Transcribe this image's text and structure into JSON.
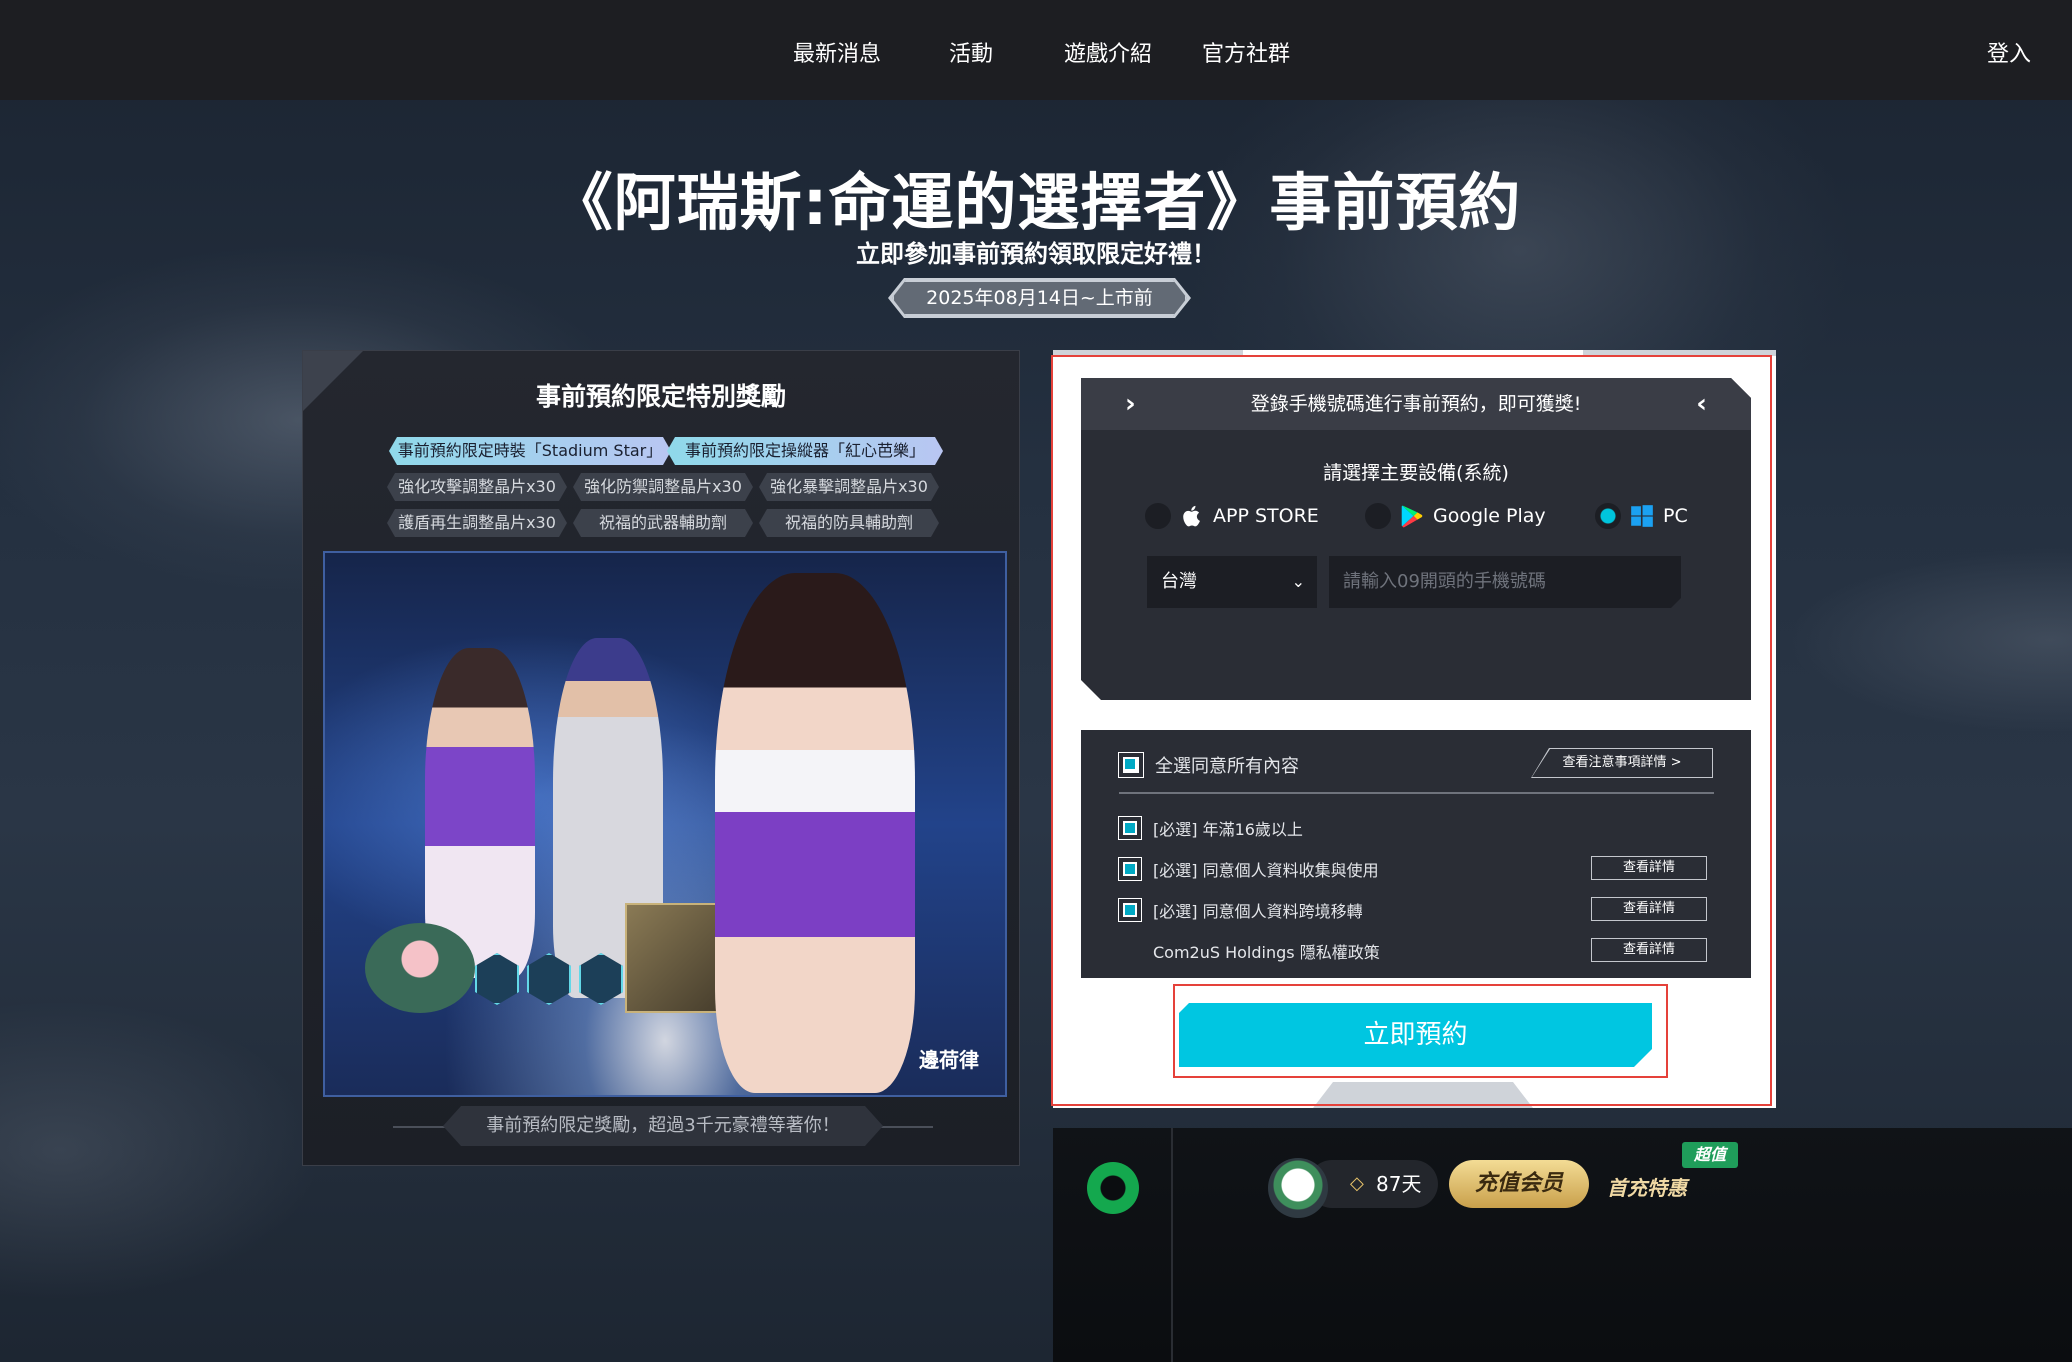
{
  "nav": {
    "items": [
      "最新消息",
      "活動",
      "遊戲介紹",
      "官方社群"
    ],
    "login": "登入"
  },
  "hero": {
    "title": "《阿瑞斯:命運的選擇者》事前預約",
    "subtitle": "立即參加事前預約領取限定好禮！",
    "date": "2025年08月14日~上市前"
  },
  "rewards": {
    "title": "事前預約限定特別獎勵",
    "highlight_tags": [
      "事前預約限定時裝「Stadium Star」",
      "事前預約限定操縱器「紅心芭樂」"
    ],
    "tags_row1": [
      "強化攻擊調整晶片x30",
      "強化防禦調整晶片x30",
      "強化暴擊調整晶片x30"
    ],
    "tags_row2": [
      "護盾再生調整晶片x30",
      "祝福的武器輔助劑",
      "祝福的防具輔助劑"
    ],
    "art_caption": "邊荷律",
    "footer": "事前預約限定獎勵，超過3千元豪禮等著你！"
  },
  "form": {
    "header": "登錄手機號碼進行事前預約，即可獲獎!",
    "device_label": "請選擇主要設備(系統)",
    "devices": [
      {
        "label": "APP STORE",
        "selected": false,
        "icon": "apple-icon"
      },
      {
        "label": "Google Play",
        "selected": false,
        "icon": "google-play-icon"
      },
      {
        "label": "PC",
        "selected": true,
        "icon": "windows-icon"
      }
    ],
    "region": "台灣",
    "phone_placeholder": "請輸入09開頭的手機號碼",
    "agree_all": "全選同意所有內容",
    "notice_details": "查看注意事項詳情 >",
    "terms": [
      {
        "label": "[必選] 年滿16歲以上",
        "checked": true,
        "has_detail": false
      },
      {
        "label": "[必選] 同意個人資料收集與使用",
        "checked": true,
        "has_detail": true
      },
      {
        "label": "[必選] 同意個人資料跨境移轉",
        "checked": true,
        "has_detail": true
      },
      {
        "label": "Com2uS Holdings 隱私權政策",
        "checked": false,
        "has_detail": true
      }
    ],
    "detail_label": "查看詳情",
    "submit": "立即預約",
    "accent_color": "#00c6e1"
  },
  "ad": {
    "days": "87天",
    "vip": "充值会员",
    "offer": "首充特惠",
    "badge": "超值"
  }
}
